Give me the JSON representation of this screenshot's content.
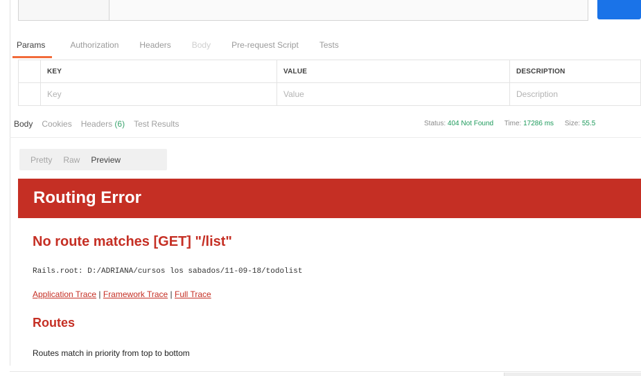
{
  "request_tabs": [
    {
      "label": "Params",
      "state": "active"
    },
    {
      "label": "Authorization",
      "state": "normal"
    },
    {
      "label": "Headers",
      "state": "normal"
    },
    {
      "label": "Body",
      "state": "disabled"
    },
    {
      "label": "Pre-request Script",
      "state": "normal"
    },
    {
      "label": "Tests",
      "state": "normal"
    }
  ],
  "params_table": {
    "headers": {
      "key": "KEY",
      "value": "VALUE",
      "description": "DESCRIPTION"
    },
    "placeholders": {
      "key": "Key",
      "value": "Value",
      "description": "Description"
    }
  },
  "response_tabs": {
    "body": "Body",
    "cookies": "Cookies",
    "headers": "Headers",
    "headers_count": "(6)",
    "test_results": "Test Results"
  },
  "status": {
    "status_label": "Status:",
    "status_value": "404 Not Found",
    "time_label": "Time:",
    "time_value": "17286 ms",
    "size_label": "Size:",
    "size_value": "55.5"
  },
  "view_modes": {
    "pretty": "Pretty",
    "raw": "Raw",
    "preview": "Preview",
    "selected": "Preview"
  },
  "error_page": {
    "title": "Routing Error",
    "message": "No route matches [GET] \"/list\"",
    "rails_root": "Rails.root: D:/ADRIANA/cursos los sabados/11-09-18/todolist",
    "traces": {
      "application": "Application Trace",
      "separator": " | ",
      "framework": "Framework Trace",
      "full": "Full Trace"
    },
    "routes_heading": "Routes",
    "routes_description": "Routes match in priority from top to bottom"
  },
  "colors": {
    "accent_tab": "#f26b3a",
    "send_button": "#1a73e8",
    "status_ok": "#1d9a5b",
    "rails_red": "#c52f24"
  }
}
